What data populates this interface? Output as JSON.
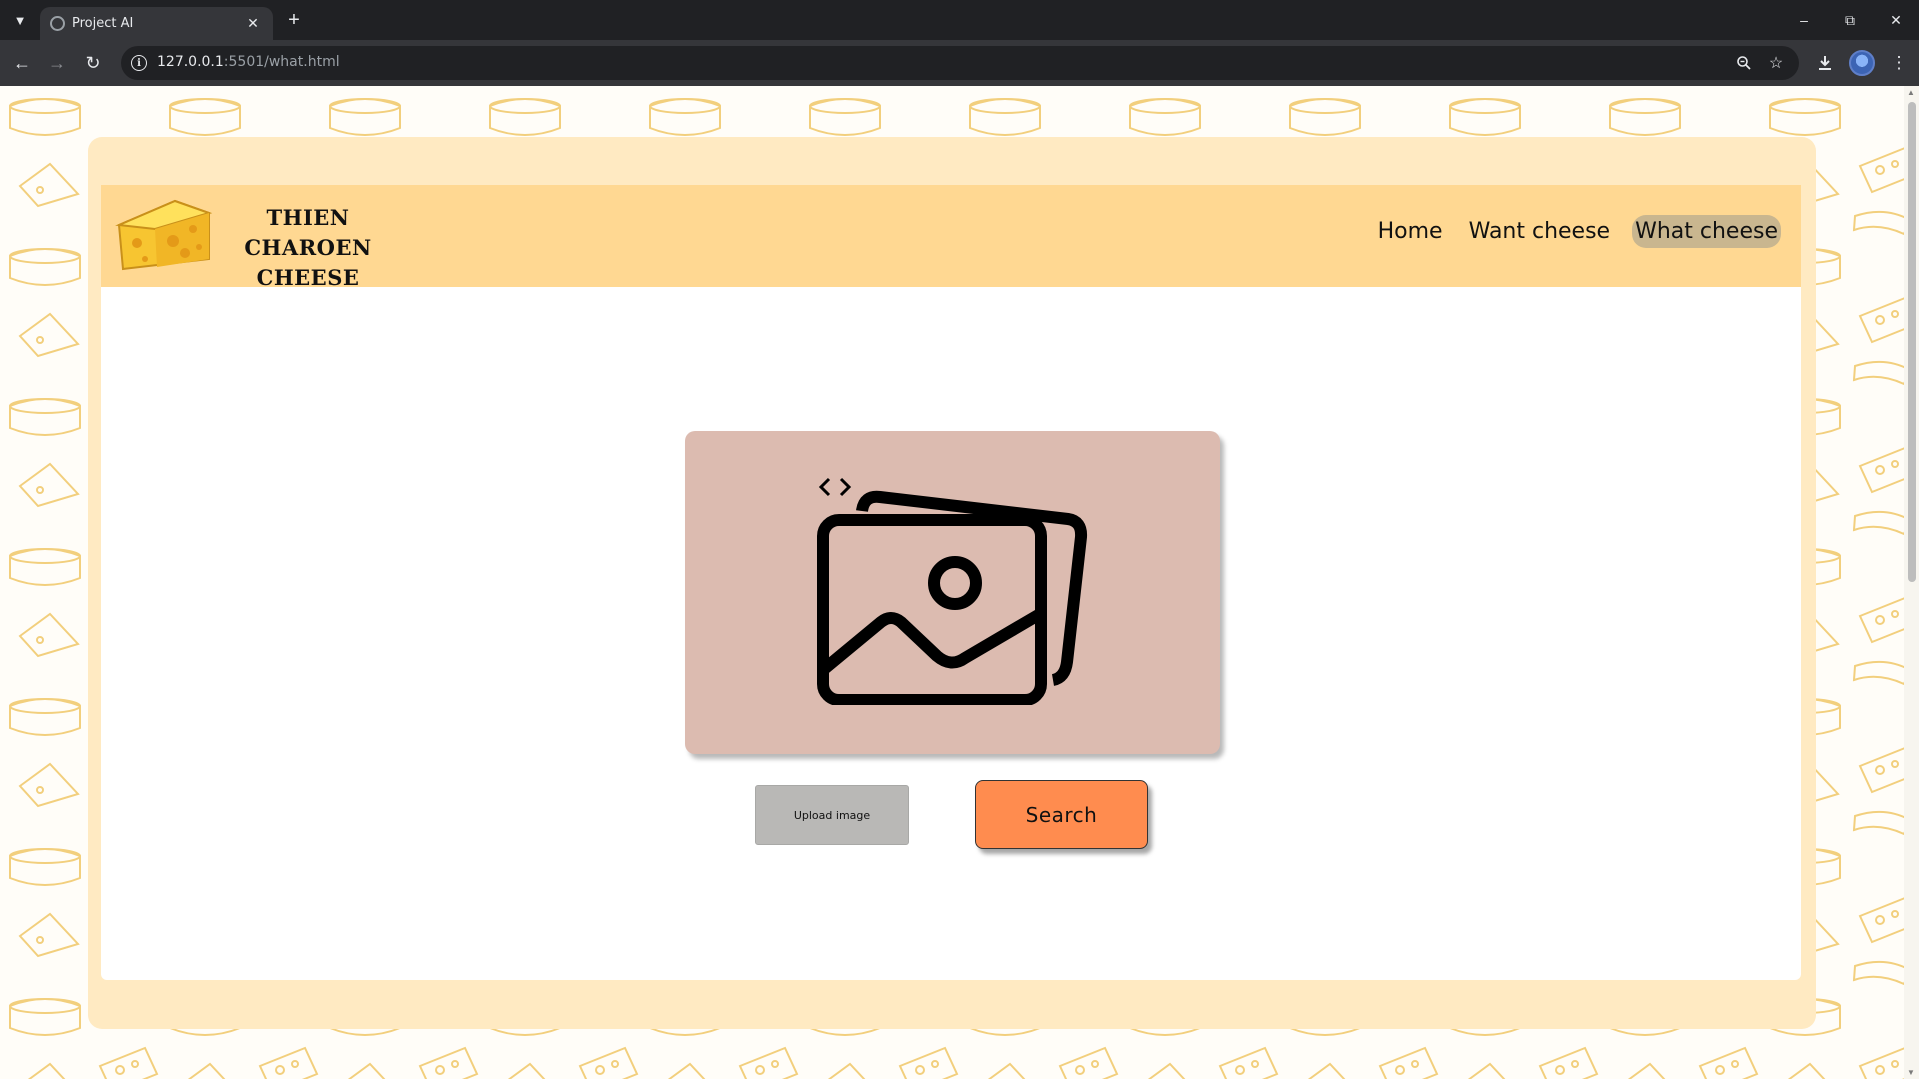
{
  "browser": {
    "tab_title": "Project AI",
    "url_host": "127.0.0.1",
    "url_path": ":5501/what.html",
    "icons": {
      "tab_list": "chevron-down-icon",
      "favicon": "globe-icon",
      "tab_close": "close-icon",
      "new_tab": "plus-icon",
      "minimize": "minimize-icon",
      "restore": "restore-icon",
      "close_window": "close-icon",
      "back": "back-arrow-icon",
      "forward": "forward-arrow-icon",
      "reload": "reload-icon",
      "site_info": "info-icon",
      "zoom": "zoom-icon",
      "bookmark": "star-icon",
      "download": "download-icon",
      "profile": "avatar",
      "menu": "kebab-menu-icon"
    }
  },
  "site": {
    "brand_line1": "THIEN CHAROEN",
    "brand_line2": "CHEESE",
    "nav": [
      {
        "label": "Home",
        "active": false
      },
      {
        "label": "Want cheese",
        "active": false
      },
      {
        "label": "What cheese",
        "active": true
      }
    ]
  },
  "main": {
    "image_placeholder_icon": "image-gallery-icon",
    "carousel_icon": "code-arrows-icon",
    "upload_label": "Upload image",
    "search_label": "Search"
  },
  "colors": {
    "page_background": "#fffdf8",
    "outer_card": "#ffeac2",
    "header": "#ffd892",
    "nav_active": "#c9b68f",
    "image_box": "#dcbbb0",
    "upload_button": "#b9b8b6",
    "search_button": "#ff8c4f"
  }
}
